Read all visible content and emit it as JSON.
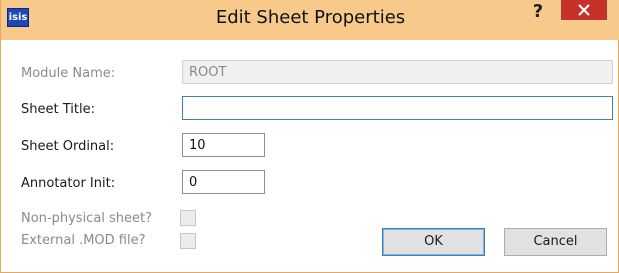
{
  "window": {
    "title": "Edit Sheet Properties",
    "app_icon_text": "isis",
    "help_label": "?",
    "titlebar_color": "#f7c98a",
    "close_color": "#c7312b"
  },
  "form": {
    "module_name": {
      "label": "Module Name:",
      "value": "ROOT",
      "enabled": false
    },
    "sheet_title": {
      "label": "Sheet Title:",
      "value": ""
    },
    "sheet_ordinal": {
      "label": "Sheet Ordinal:",
      "value": "10"
    },
    "annotator_init": {
      "label": "Annotator Init:",
      "value": "0"
    },
    "non_physical": {
      "label": "Non-physical sheet?",
      "checked": false,
      "enabled": false
    },
    "external_mod": {
      "label": "External .MOD file?",
      "checked": false,
      "enabled": false
    }
  },
  "buttons": {
    "ok_label": "OK",
    "cancel_label": "Cancel"
  }
}
